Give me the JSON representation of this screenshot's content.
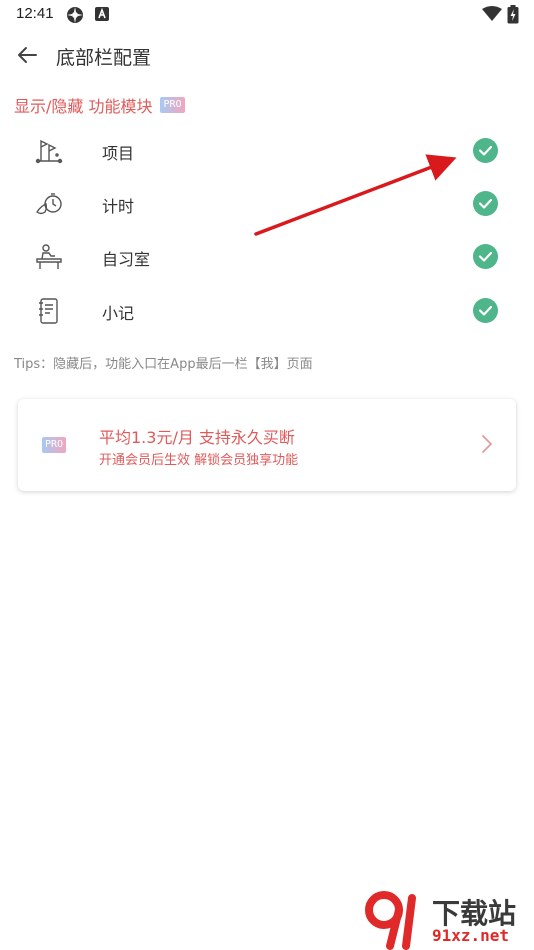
{
  "status_bar": {
    "time": "12:41",
    "icons": [
      "settings-icon",
      "a-notification-icon",
      "wifi-icon",
      "battery-icon"
    ]
  },
  "header": {
    "back_icon": "arrow-left-icon",
    "title": "底部栏配置"
  },
  "section": {
    "title": "显示/隐藏 功能模块",
    "badge": "PRO"
  },
  "modules": [
    {
      "label": "项目",
      "icon": "project-flag-icon",
      "checked": true
    },
    {
      "label": "计时",
      "icon": "timer-hand-icon",
      "checked": true
    },
    {
      "label": "自习室",
      "icon": "study-desk-icon",
      "checked": true
    },
    {
      "label": "小记",
      "icon": "notebook-icon",
      "checked": true
    }
  ],
  "tips": "Tips：隐藏后，功能入口在App最后一栏【我】页面",
  "promo": {
    "badge": "PRO",
    "title": "平均1.3元/月 支持永久买断",
    "subtitle": "开通会员后生效 解锁会员独享功能"
  },
  "watermark": {
    "main": "下载站",
    "sub": "91xz.net"
  },
  "colors": {
    "accent": "#e05a5a",
    "check": "#4fb58a",
    "arrow": "#d9191c"
  }
}
